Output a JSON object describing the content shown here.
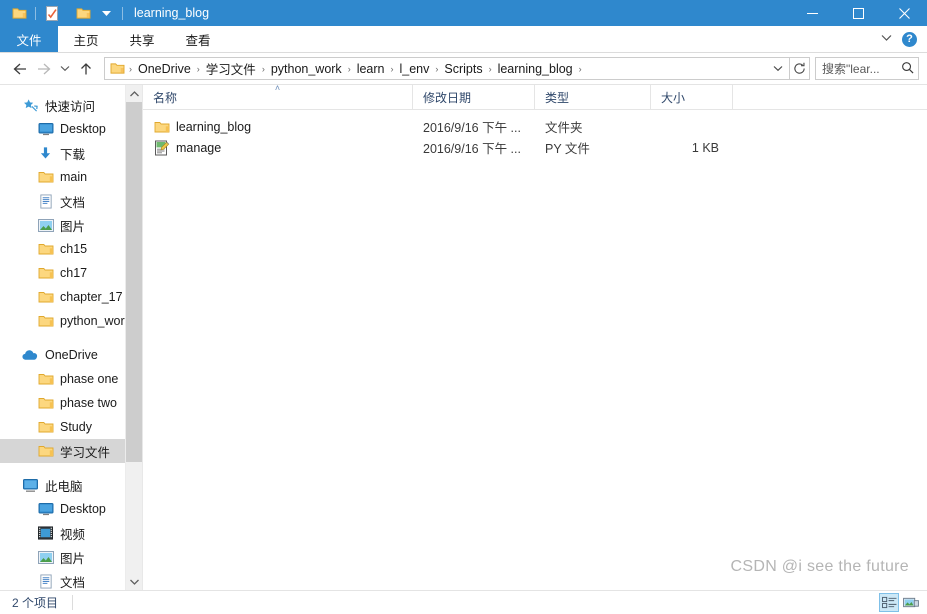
{
  "window": {
    "title": "learning_blog",
    "quick_access": [
      {
        "name": "folder-properties-icon",
        "label": "属性"
      },
      {
        "name": "new-folder-icon",
        "label": "新建文件夹"
      },
      {
        "name": "customize-qat-chevron-icon",
        "label": "自定义快速访问工具栏"
      }
    ],
    "controls": {
      "minimize": "─",
      "maximize": "□",
      "close": "✕"
    }
  },
  "ribbon": {
    "tabs": [
      {
        "label": "文件",
        "active": true
      },
      {
        "label": "主页",
        "active": false
      },
      {
        "label": "共享",
        "active": false
      },
      {
        "label": "查看",
        "active": false
      }
    ],
    "expand_chevron": "⌄",
    "help_label": "?"
  },
  "navbar": {
    "back": "←",
    "forward": "→",
    "recent": "⌄",
    "up": "↑",
    "breadcrumbs": [
      "OneDrive",
      "学习文件",
      "python_work",
      "learn",
      "l_env",
      "Scripts",
      "learning_blog"
    ],
    "separator": "›",
    "dropdown_chevron": "⌄",
    "refresh": "↻",
    "search_placeholder": "搜索\"lear..."
  },
  "sidebar": {
    "groups": [
      {
        "header": {
          "label": "快速访问",
          "icon": "star-pin-icon"
        },
        "items": [
          {
            "label": "Desktop",
            "icon": "monitor-icon",
            "pinned": true
          },
          {
            "label": "下载",
            "icon": "download-arrow-icon",
            "pinned": true
          },
          {
            "label": "main",
            "icon": "folder-icon",
            "pinned": true
          },
          {
            "label": "文档",
            "icon": "document-icon",
            "pinned": true
          },
          {
            "label": "图片",
            "icon": "picture-icon",
            "pinned": true
          },
          {
            "label": "ch15",
            "icon": "folder-icon",
            "pinned": false
          },
          {
            "label": "ch17",
            "icon": "folder-icon",
            "pinned": false
          },
          {
            "label": "chapter_17",
            "icon": "folder-icon",
            "pinned": false
          },
          {
            "label": "python_work",
            "icon": "folder-icon",
            "pinned": false
          }
        ]
      },
      {
        "header": {
          "label": "OneDrive",
          "icon": "cloud-icon"
        },
        "items": [
          {
            "label": "phase one",
            "icon": "folder-icon",
            "pinned": false
          },
          {
            "label": "phase two",
            "icon": "folder-icon",
            "pinned": false
          },
          {
            "label": "Study",
            "icon": "folder-icon",
            "pinned": false
          },
          {
            "label": "学习文件",
            "icon": "folder-icon",
            "pinned": false,
            "selected": true
          }
        ]
      },
      {
        "header": {
          "label": "此电脑",
          "icon": "computer-icon"
        },
        "items": [
          {
            "label": "Desktop",
            "icon": "monitor-icon",
            "pinned": false
          },
          {
            "label": "视频",
            "icon": "video-icon",
            "pinned": false
          },
          {
            "label": "图片",
            "icon": "picture-icon",
            "pinned": false
          },
          {
            "label": "文档",
            "icon": "document-icon",
            "pinned": false
          }
        ]
      }
    ]
  },
  "filelist": {
    "columns": [
      {
        "label": "名称",
        "sorted": "asc"
      },
      {
        "label": "修改日期",
        "sorted": ""
      },
      {
        "label": "类型",
        "sorted": ""
      },
      {
        "label": "大小",
        "sorted": ""
      }
    ],
    "sort_caret": "˄",
    "rows": [
      {
        "name": "learning_blog",
        "date": "2016/9/16 下午 ...",
        "type": "文件夹",
        "size": "",
        "icon": "folder-icon"
      },
      {
        "name": "manage",
        "date": "2016/9/16 下午 ...",
        "type": "PY 文件",
        "size": "1 KB",
        "icon": "python-file-icon"
      }
    ],
    "watermark": "CSDN @i see the future"
  },
  "statusbar": {
    "item_count": "2 个项目",
    "views": [
      {
        "name": "details-view",
        "active": true
      },
      {
        "name": "large-icons-view",
        "active": false
      }
    ]
  },
  "colors": {
    "accent": "#2f88cd",
    "folder": "#fcd77f",
    "selection": "#d6d6d6",
    "header_text": "#30486b"
  }
}
